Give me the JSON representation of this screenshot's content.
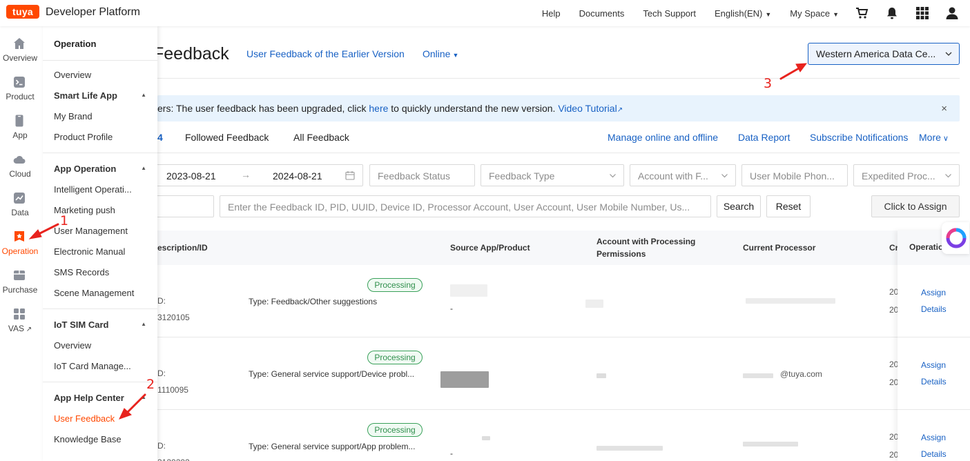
{
  "header": {
    "logo_text": "tuya",
    "brand": "Developer Platform",
    "nav": [
      "Help",
      "Documents",
      "Tech Support",
      "English(EN)",
      "My Space"
    ],
    "icons": [
      "cart-icon",
      "bell-icon",
      "apps-grid-icon",
      "user-icon"
    ]
  },
  "rail": {
    "items": [
      {
        "label": "Overview",
        "icon": "home-icon"
      },
      {
        "label": "Product",
        "icon": "terminal-icon"
      },
      {
        "label": "App",
        "icon": "phone-icon"
      },
      {
        "label": "Cloud",
        "icon": "cloud-icon"
      },
      {
        "label": "Data",
        "icon": "chart-icon"
      },
      {
        "label": "Operation",
        "icon": "star-badge-icon",
        "active": true
      },
      {
        "label": "Purchase",
        "icon": "box-icon"
      },
      {
        "label": "VAS",
        "icon": "external-link-icon"
      }
    ]
  },
  "submenu": {
    "title": "Operation",
    "overview": "Overview",
    "groups": [
      {
        "title": "Smart Life App",
        "items": [
          "My Brand",
          "Product Profile"
        ]
      },
      {
        "title": "App Operation",
        "items": [
          "Intelligent Operati...",
          "Marketing push",
          "User Management",
          "Electronic Manual",
          "SMS Records",
          "Scene Management"
        ]
      },
      {
        "title": "IoT SIM Card",
        "items": [
          "Overview",
          "IoT Card Manage..."
        ]
      },
      {
        "title": "App Help Center",
        "items": [
          "User Feedback",
          "Knowledge Base"
        ]
      }
    ],
    "active_item": "User Feedback"
  },
  "main": {
    "title": "Feedback",
    "earlier_link": "User Feedback of the Earlier Version",
    "online_select": "Online",
    "data_center": "Western America Data Ce...",
    "notice": {
      "text_before": "ers: The user feedback has been upgraded, click ",
      "link_here": "here",
      "text_after": " to quickly understand the new version. ",
      "link_tutorial": "Video Tutorial",
      "close": "×"
    },
    "tabs": {
      "active_suffix": "4",
      "followed": "Followed Feedback",
      "all": "All Feedback",
      "actions": [
        "Manage online and offline",
        "Data Report",
        "Subscribe Notifications",
        "More"
      ]
    },
    "filters": {
      "date_start": "2023-08-21",
      "date_sep": "→",
      "date_end": "2024-08-21",
      "feedback_status": "Feedback Status",
      "feedback_type": "Feedback Type",
      "account": "Account with F...",
      "user_mobile": "User Mobile Phon...",
      "expedited": "Expedited Proc...",
      "search_placeholder": "Enter the Feedback ID, PID, UUID, Device ID, Processor Account, User Account, User Mobile Number, Us...",
      "search_btn": "Search",
      "reset_btn": "Reset",
      "assign_btn": "Click to Assign"
    },
    "table": {
      "columns": [
        "escription/ID",
        "Source App/Product",
        "Account with Processing Permissions",
        "Current Processor",
        "Cr",
        "Operatio..."
      ],
      "rows": [
        {
          "status": "Processing",
          "type": "Type: Feedback/Other suggestions",
          "source": "-",
          "frag_a": "D:",
          "frag_b": "3120105",
          "date1": "20",
          "date2": "20",
          "assign": "Assign",
          "details": "Details",
          "processor": ""
        },
        {
          "status": "Processing",
          "type": "Type: General service support/Device probl...",
          "source": "",
          "frag_a": "D:",
          "frag_b": "1110095",
          "date1": "20",
          "date2": "20",
          "assign": "Assign",
          "details": "Details",
          "processor": "@tuya.com"
        },
        {
          "status": "Processing",
          "type": "Type: General service support/App problem...",
          "source": "-",
          "frag_a": "D:",
          "frag_b": "3120202",
          "date1": "20",
          "date2": "20",
          "assign": "Assign",
          "details": "Details",
          "processor": ""
        }
      ]
    }
  },
  "annotations": [
    "1",
    "2",
    "3"
  ],
  "colors": {
    "accent": "#1861c4",
    "brand": "#ff4800",
    "annotation": "#e8231e",
    "status_green": "#3aa15a"
  }
}
